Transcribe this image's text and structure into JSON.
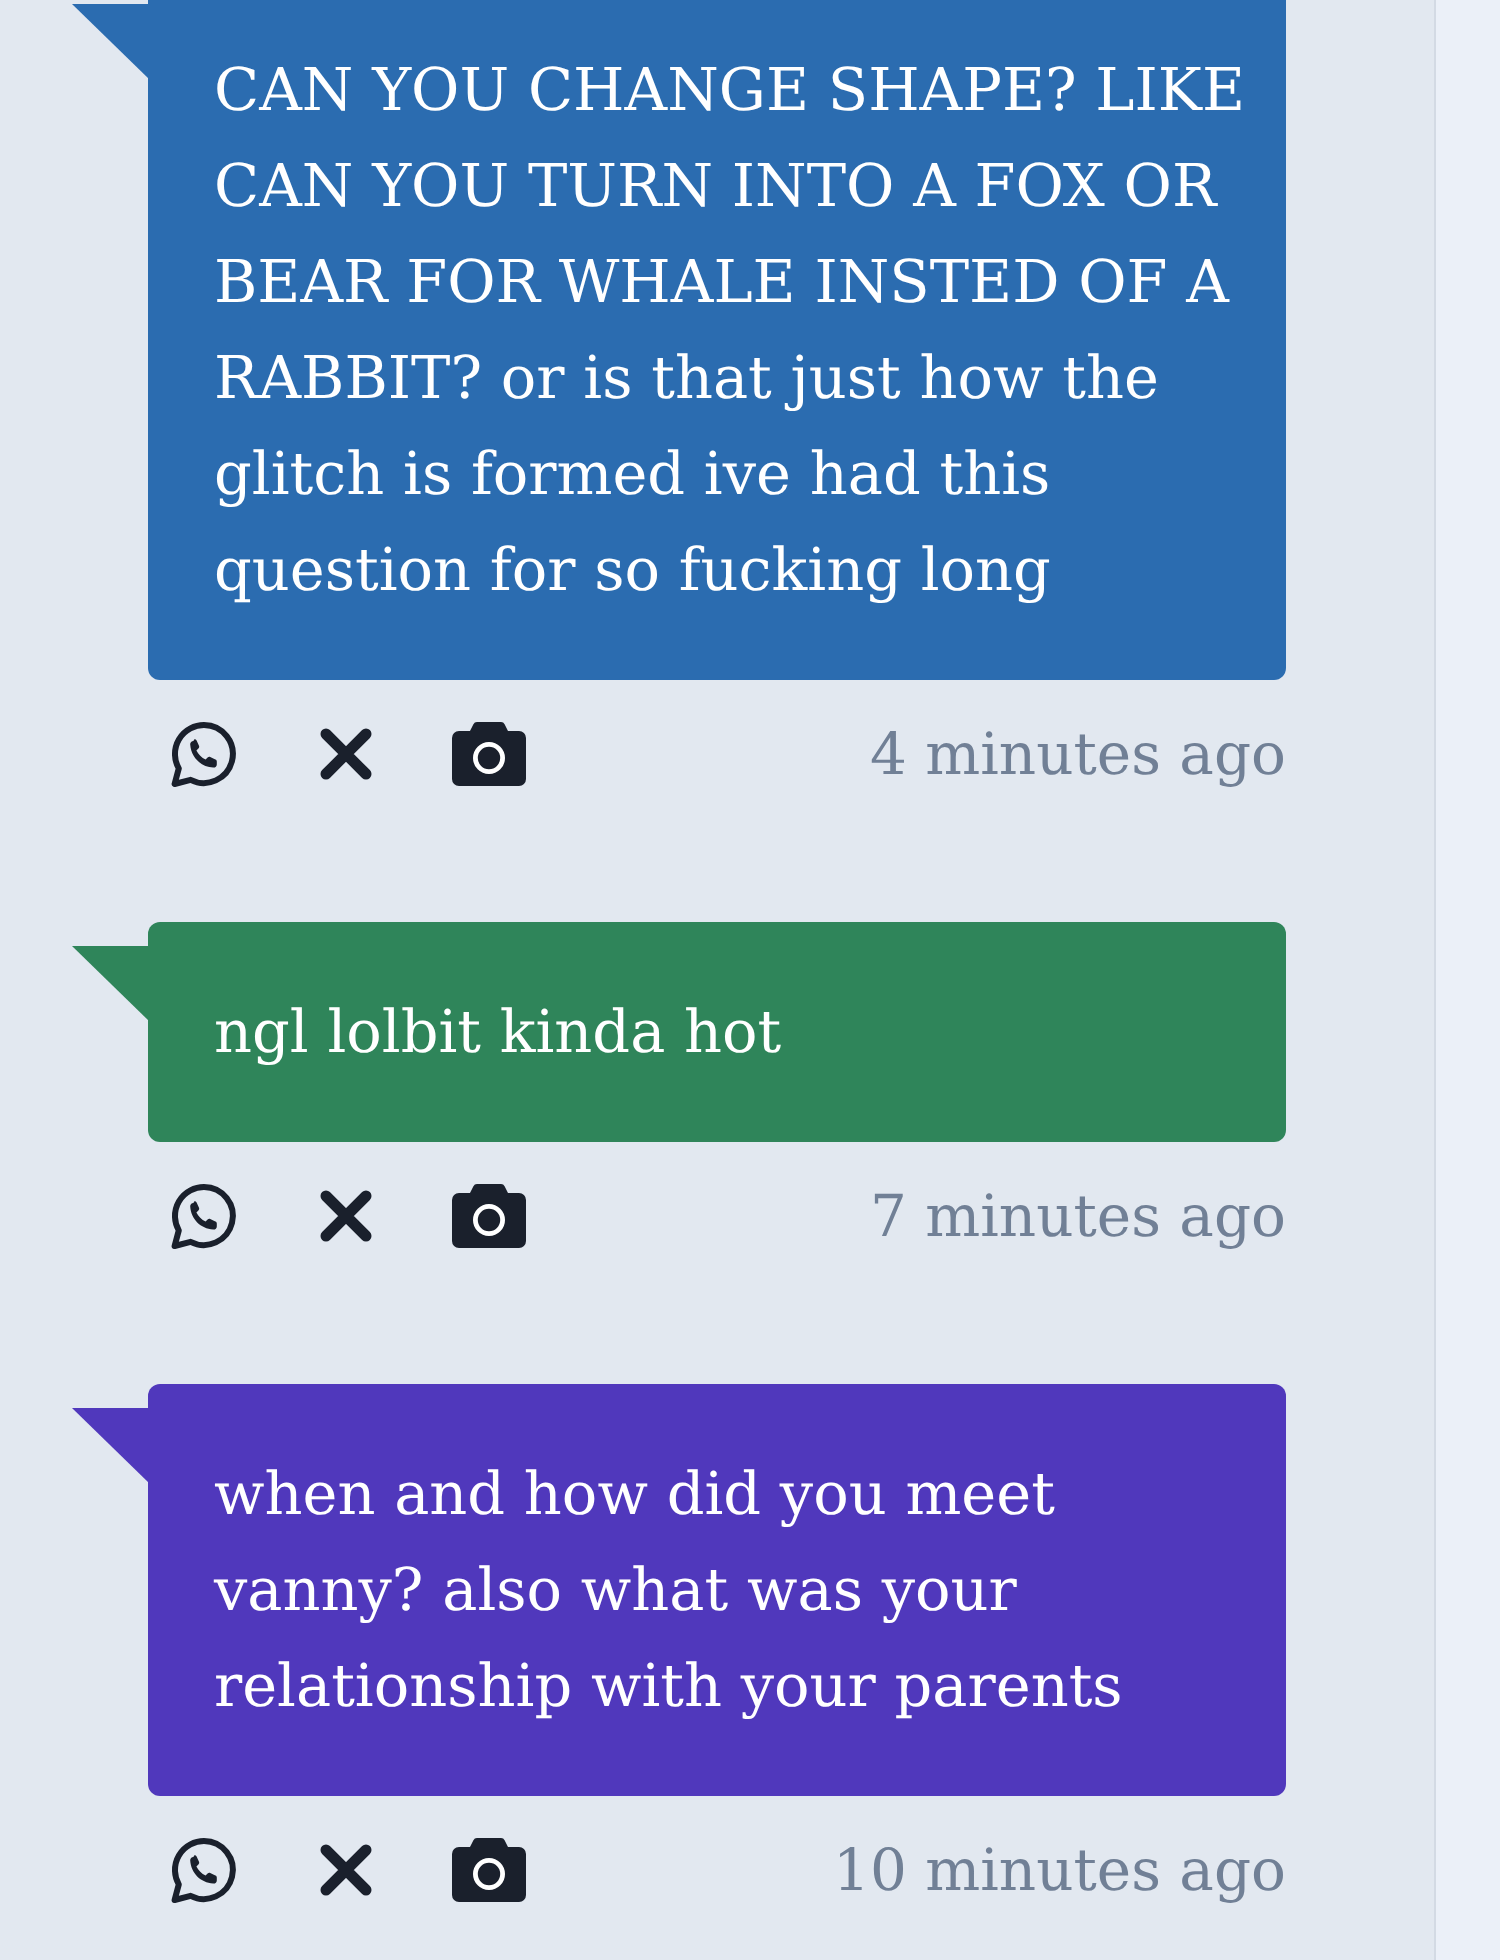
{
  "messages": [
    {
      "text": "CAN YOU CHANGE SHAPE? LIKE CAN YOU TURN INTO A FOX OR BEAR FOR WHALE INSTED OF A RABBIT? or is that just how the glitch is formed ive had this question for so fucking long",
      "color": "#2b6cb0",
      "time": "4 minutes ago"
    },
    {
      "text": "ngl lolbit kinda hot",
      "color": "#2f855a",
      "time": "7 minutes ago"
    },
    {
      "text": "when and how did you meet vanny? also what was your relationship with your parents",
      "color": "#5038bc",
      "time": "10 minutes ago"
    }
  ]
}
